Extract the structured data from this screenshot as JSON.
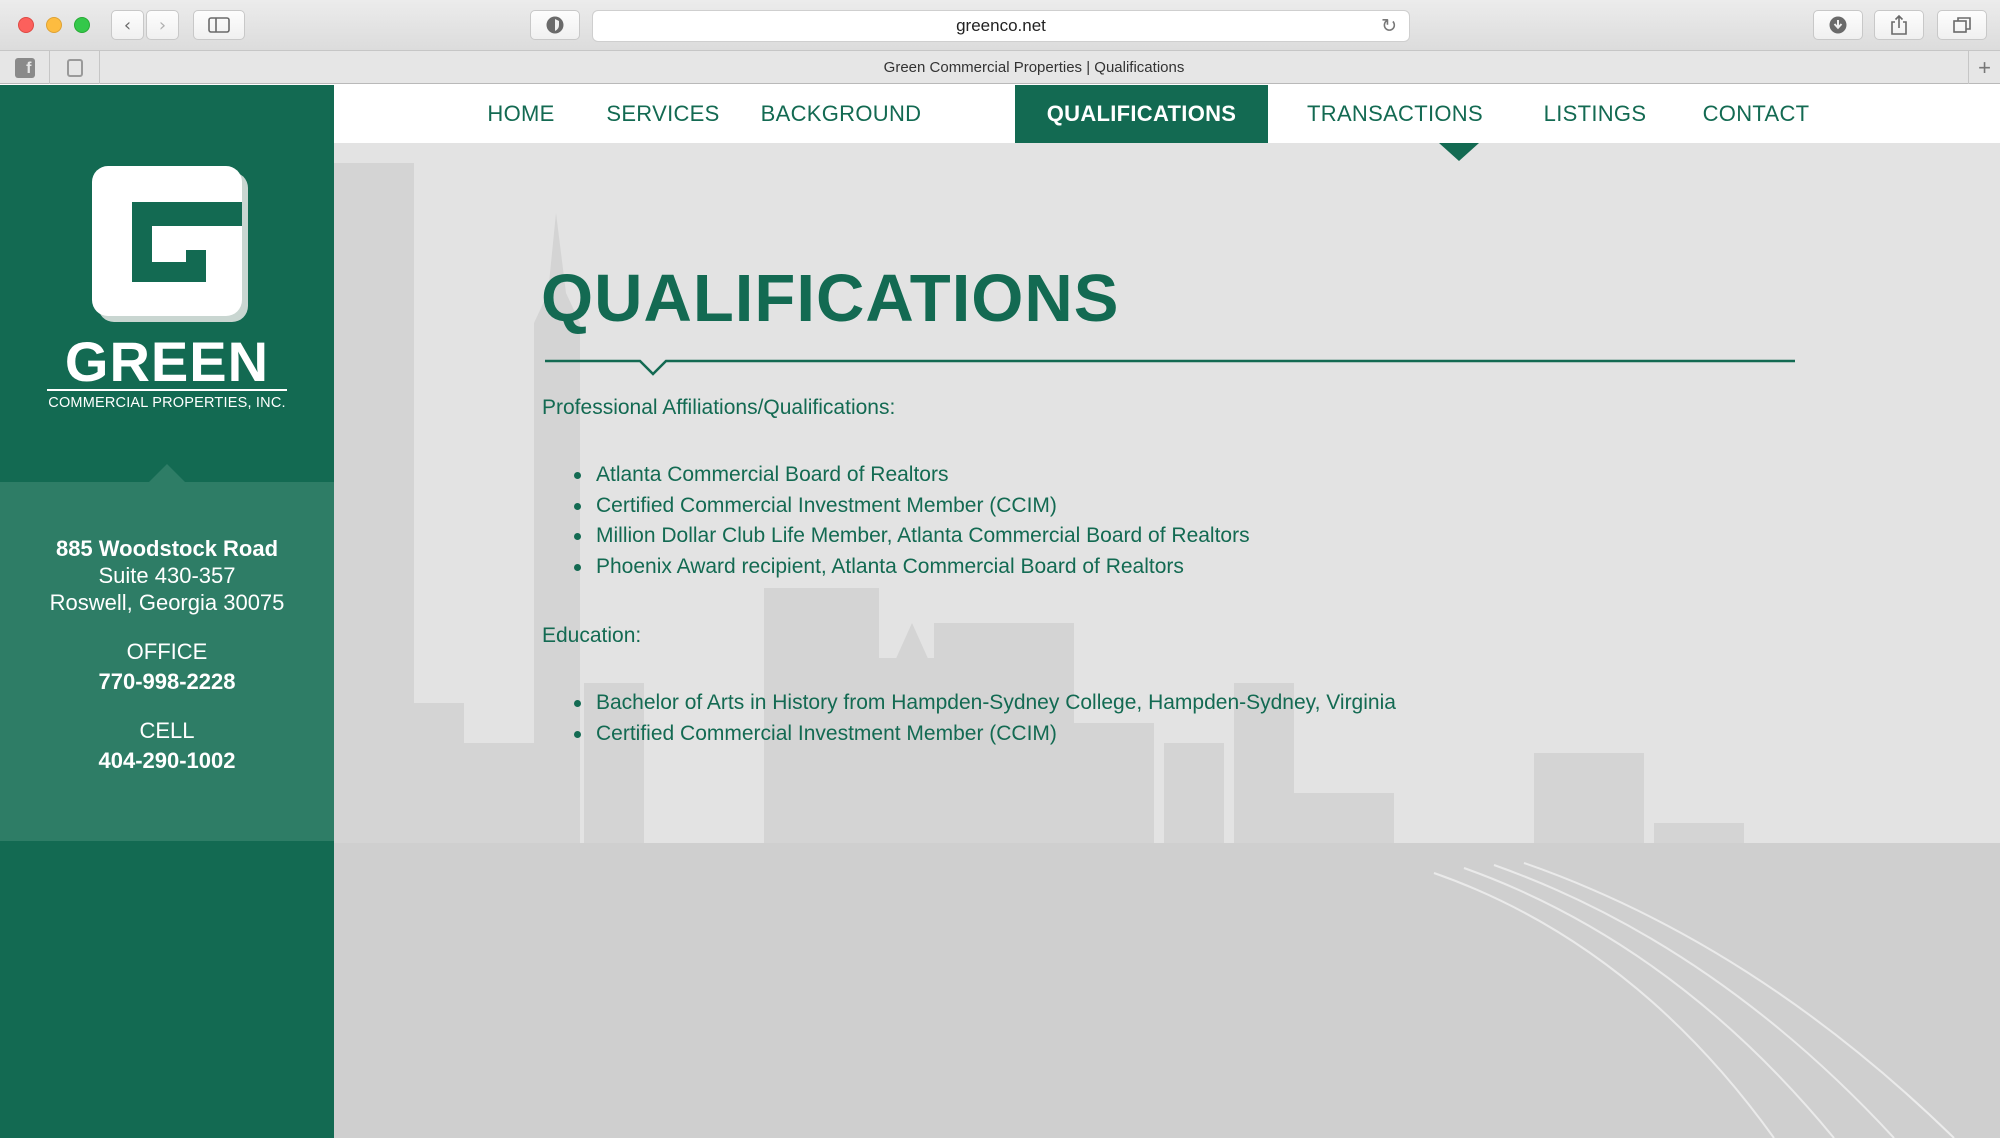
{
  "browser": {
    "url": "greenco.net",
    "tab_title": "Green Commercial Properties | Qualifications",
    "tab_add_glyph": "+"
  },
  "colors": {
    "brand_green": "#136a52",
    "panel_green": "#2e7d66",
    "nav_background": "#ffffff"
  },
  "icons": {
    "back": "chevron-left-icon",
    "forward": "chevron-right-icon",
    "sidebar": "sidebar-icon",
    "privacy": "shield-icon",
    "reload": "reload-icon",
    "download": "download-icon",
    "share": "share-icon",
    "tabs": "tabs-icon",
    "facebook": "facebook-icon",
    "robot": "robot-icon"
  },
  "sidebar": {
    "brand_name": "GREEN",
    "brand_sub": "COMMERCIAL PROPERTIES, INC.",
    "address_street": "885 Woodstock Road",
    "address_suite": "Suite 430-357",
    "address_city": "Roswell, Georgia 30075",
    "office_label": "OFFICE",
    "office_phone": "770-998-2228",
    "cell_label": "CELL",
    "cell_phone": "404-290-1002"
  },
  "nav": {
    "items": [
      {
        "label": "HOME",
        "active": false
      },
      {
        "label": "SERVICES",
        "active": false
      },
      {
        "label": "BACKGROUND",
        "active": false
      },
      {
        "label": "QUALIFICATIONS",
        "active": true
      },
      {
        "label": "TRANSACTIONS",
        "active": false
      },
      {
        "label": "LISTINGS",
        "active": false
      },
      {
        "label": "CONTACT",
        "active": false
      }
    ]
  },
  "content": {
    "heading": "QUALIFICATIONS",
    "affiliations_label": "Professional Affiliations/Qualifications:",
    "affiliations": [
      "Atlanta Commercial Board of Realtors",
      "Certified Commercial Investment Member (CCIM)",
      "Million Dollar Club Life Member, Atlanta Commercial Board of Realtors",
      "Phoenix Award recipient, Atlanta Commercial Board of Realtors"
    ],
    "education_label": "Education:",
    "education": [
      "Bachelor of Arts in History from Hampden-Sydney College, Hampden-Sydney, Virginia",
      "Certified Commercial Investment Member (CCIM)"
    ]
  }
}
